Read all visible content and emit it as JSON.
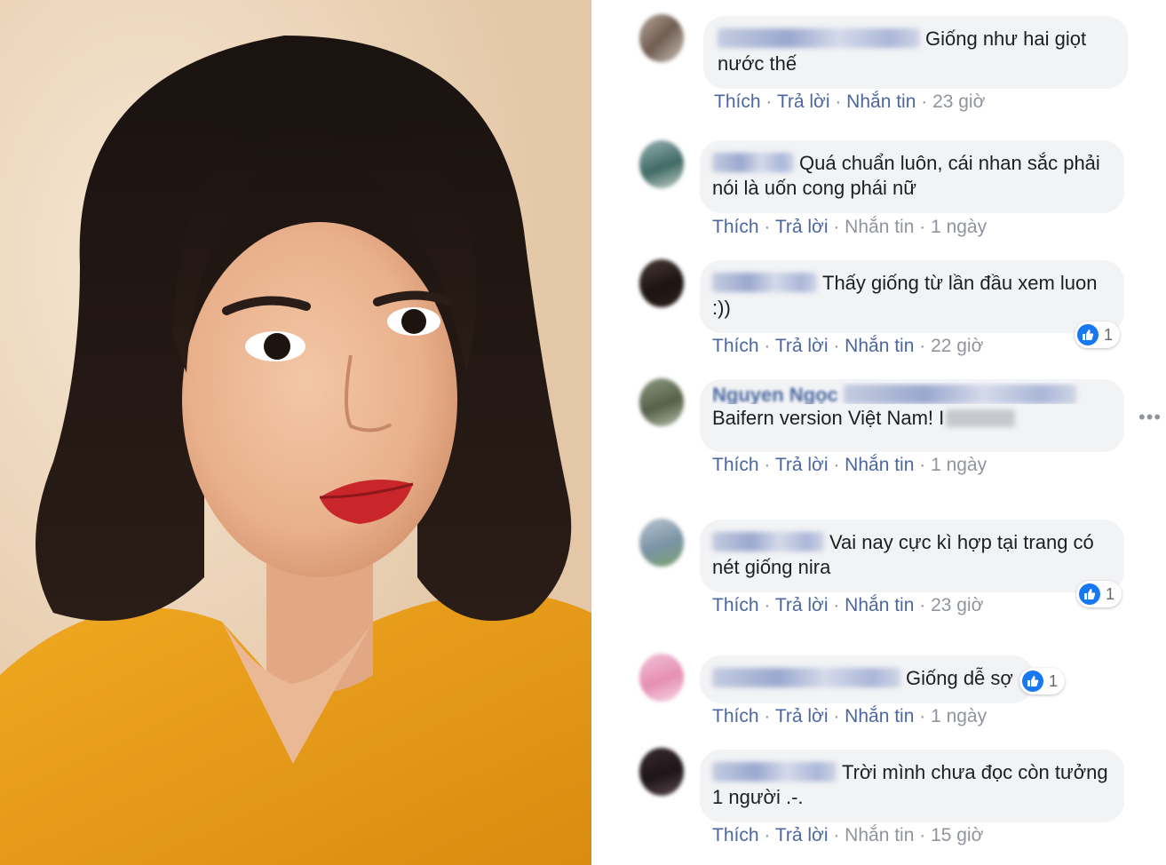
{
  "photo": {
    "subject": "portrait-woman"
  },
  "comments": [
    {
      "text": "Giống như hai giọt nước thế",
      "actions": [
        "Thích",
        "Trả lời",
        "Nhắn tin"
      ],
      "time": "23 giờ"
    },
    {
      "text": "Quá chuẩn luôn, cái nhan sắc phải nói là uốn cong phái nữ",
      "actions": [
        "Thích",
        "Trả lời",
        "Nhắn tin"
      ],
      "time": "1 ngày"
    },
    {
      "text": "Thấy giống từ lần đầu xem luon :))",
      "actions": [
        "Thích",
        "Trả lời",
        "Nhắn tin"
      ],
      "time": "22 giờ",
      "likes": "1"
    },
    {
      "name_fragment": "Nguyen Ngọc",
      "text": "Baifern version Việt Nam! I",
      "actions": [
        "Thích",
        "Trả lời",
        "Nhắn tin"
      ],
      "time": "1 ngày"
    },
    {
      "text": "Vai nay cực kì hợp tại trang có nét giống nira",
      "actions": [
        "Thích",
        "Trả lời",
        "Nhắn tin"
      ],
      "time": "23 giờ",
      "likes": "1"
    },
    {
      "text": "Giống dễ sợ",
      "actions": [
        "Thích",
        "Trả lời",
        "Nhắn tin"
      ],
      "time": "1 ngày",
      "likes": "1"
    },
    {
      "text": "Trời mình chưa đọc còn tưởng 1 người .-.",
      "actions": [
        "Thích",
        "Trả lời",
        "Nhắn tin"
      ],
      "time": "15 giờ"
    }
  ],
  "more_menu": "•••",
  "colors": {
    "link": "#4b67a1",
    "muted": "#90949c",
    "bubble": "#f2f3f5",
    "like": "#1877f2"
  }
}
